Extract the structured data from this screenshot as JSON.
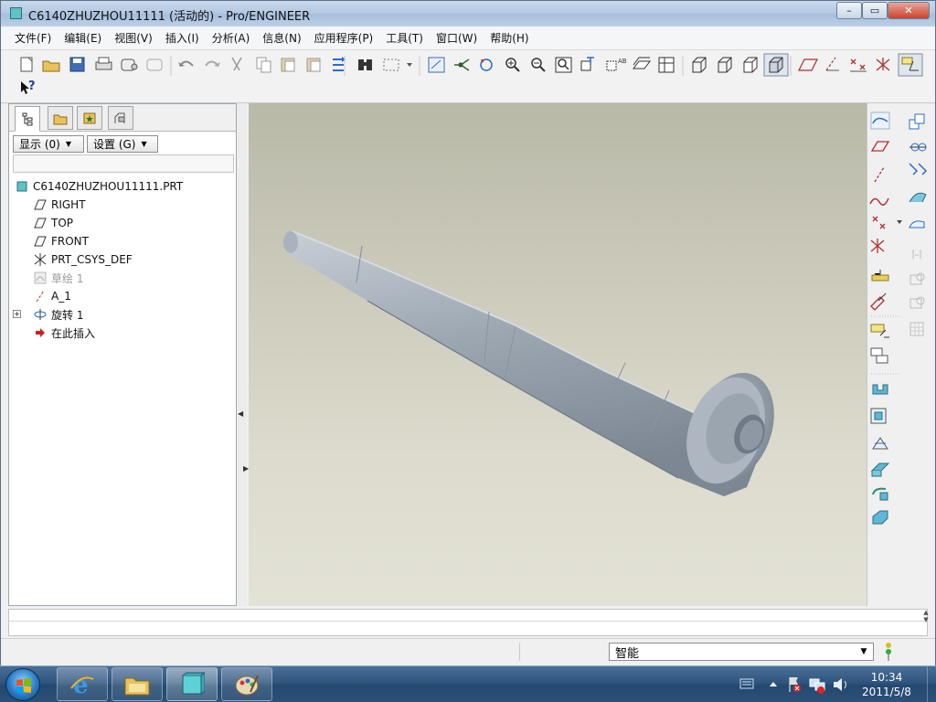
{
  "window": {
    "title": "C6140ZHUZHOU11111 (活动的) - Pro/ENGINEER",
    "min_glyph": "–",
    "max_glyph": "▭",
    "close_glyph": "✕"
  },
  "menubar": {
    "items": [
      "文件(F)",
      "编辑(E)",
      "视图(V)",
      "插入(I)",
      "分析(A)",
      "信息(N)",
      "应用程序(P)",
      "工具(T)",
      "窗口(W)",
      "帮助(H)"
    ]
  },
  "toolbar": {
    "icons": [
      "new-icon",
      "open-icon",
      "save-icon",
      "print-icon",
      "send-mail-icon",
      "close-window-icon",
      "undo-icon",
      "redo-icon",
      "cut-icon",
      "copy-icon",
      "paste-icon",
      "paste-special-icon",
      "regenerate-icon",
      "find-icon",
      "select-box-icon",
      "redraw-icon",
      "spin-center-icon",
      "orient-icon",
      "zoom-in-icon",
      "zoom-out-icon",
      "refit-icon",
      "reorient-icon",
      "view-manager-icon",
      "layers-icon",
      "saved-views-icon",
      "wireframe-icon",
      "hidden-line-icon",
      "no-hidden-icon",
      "shading-icon",
      "datum-planes-icon",
      "datum-axes-icon",
      "datum-points-icon",
      "csys-icon",
      "annotations-icon"
    ],
    "help_glyph": "?"
  },
  "model_tree": {
    "show_button": "显示 (0)",
    "settings_button": "设置 (G)",
    "items": [
      {
        "label": "C6140ZHUZHOU11111.PRT",
        "icon": "part-icon",
        "dim": false
      },
      {
        "label": "RIGHT",
        "icon": "datum-plane-icon",
        "dim": false
      },
      {
        "label": "TOP",
        "icon": "datum-plane-icon",
        "dim": false
      },
      {
        "label": "FRONT",
        "icon": "datum-plane-icon",
        "dim": false
      },
      {
        "label": "PRT_CSYS_DEF",
        "icon": "csys-icon",
        "dim": false
      },
      {
        "label": "草绘 1",
        "icon": "sketch-icon",
        "dim": true
      },
      {
        "label": "A_1",
        "icon": "datum-axis-icon",
        "dim": false
      },
      {
        "label": "旋转 1",
        "icon": "revolve-icon",
        "dim": false
      },
      {
        "label": "在此插入",
        "icon": "insert-here-icon",
        "dim": false
      }
    ]
  },
  "status": {
    "filter_value": "智能"
  },
  "taskbar": {
    "time": "10:34",
    "date": "2011/5/8"
  },
  "colors": {
    "viewport_top": "#b9b9a8",
    "viewport_bottom": "#e3e2d6",
    "model_shade": "#9aa3ad"
  }
}
